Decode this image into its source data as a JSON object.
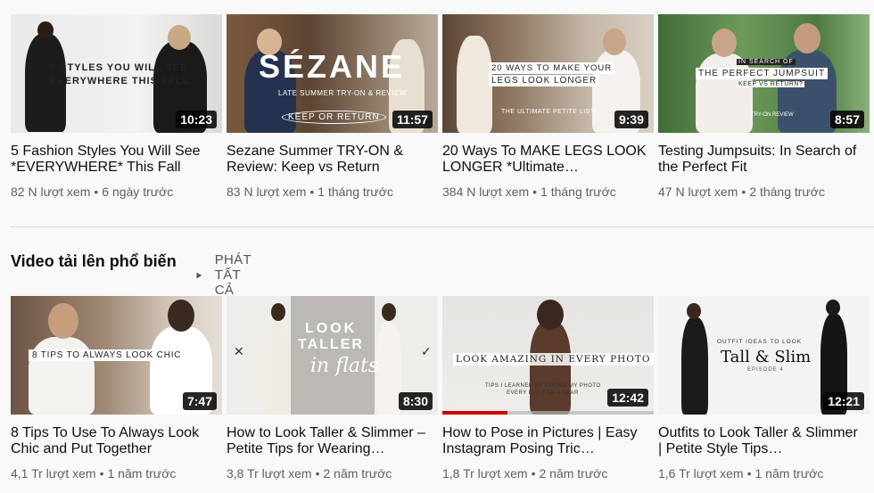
{
  "top_videos": [
    {
      "title": "5 Fashion Styles You Will See *EVERYWHERE* This Fall",
      "views": "82 N lượt xem",
      "age": "6 ngày trước",
      "duration": "10:23",
      "overlay_line1": "5 STYLES YOU WILL SEE",
      "overlay_line2": "EVERYWHERE THIS FALL"
    },
    {
      "title": "Sezane Summer TRY-ON & Review: Keep vs Return",
      "views": "83 N lượt xem",
      "age": "1 tháng trước",
      "duration": "11:57",
      "overlay_brand": "SÉZANE",
      "overlay_sub": "LATE SUMMER TRY-ON & REVIEW",
      "overlay_tag": "KEEP OR RETURN"
    },
    {
      "title": "20 Ways To MAKE LEGS LOOK LONGER *Ultimate…",
      "views": "384 N lượt xem",
      "age": "1 tháng trước",
      "duration": "9:39",
      "overlay_line1": "20 WAYS TO MAKE YOUR",
      "overlay_line2": "LEGS LOOK LONGER",
      "overlay_tag": "THE ULTIMATE PETITE LIST!"
    },
    {
      "title": "Testing Jumpsuits: In Search of the Perfect Fit",
      "views": "47 N lượt xem",
      "age": "2 tháng trước",
      "duration": "8:57",
      "overlay_line1": "IN SEARCH OF",
      "overlay_line2": "THE PERFECT JUMPSUIT",
      "overlay_line3": "KEEP VS RETURN?",
      "overlay_tag": "TRY-ON REVIEW"
    }
  ],
  "section": {
    "title": "Video tải lên phổ biến",
    "play_all_label": "PHÁT TẤT CẢ"
  },
  "popular_videos": [
    {
      "title": "8 Tips To Use To Always Look Chic and Put Together",
      "views": "4,1 Tr lượt xem",
      "age": "1 năm trước",
      "duration": "7:47",
      "overlay_line1": "8 TIPS TO ALWAYS LOOK CHIC"
    },
    {
      "title": "How to Look Taller & Slimmer – Petite Tips for Wearing…",
      "views": "3,8 Tr lượt xem",
      "age": "2 năm trước",
      "duration": "8:30",
      "overlay_line1": "LOOK",
      "overlay_line2": "TALLER",
      "overlay_line3": "in flats"
    },
    {
      "title": "How to Pose in Pictures | Easy Instagram Posing Tric…",
      "views": "1,8 Tr lượt xem",
      "age": "2 năm trước",
      "duration": "12:42",
      "watched_fraction": 0.31,
      "overlay_line1": "LOOK AMAZING IN EVERY PHOTO",
      "overlay_line2": "TIPS I LEARNED BY TAKING MY PHOTO",
      "overlay_line3": "EVERY DAY FOR A YEAR"
    },
    {
      "title": "Outfits to Look Taller & Slimmer | Petite Style Tips…",
      "views": "1,6 Tr lượt xem",
      "age": "1 năm trước",
      "duration": "12:21",
      "overlay_line1": "OUTFIT IDEAS TO LOOK",
      "overlay_line2": "Tall & Slim",
      "overlay_line3": "EPISODE 4"
    }
  ]
}
